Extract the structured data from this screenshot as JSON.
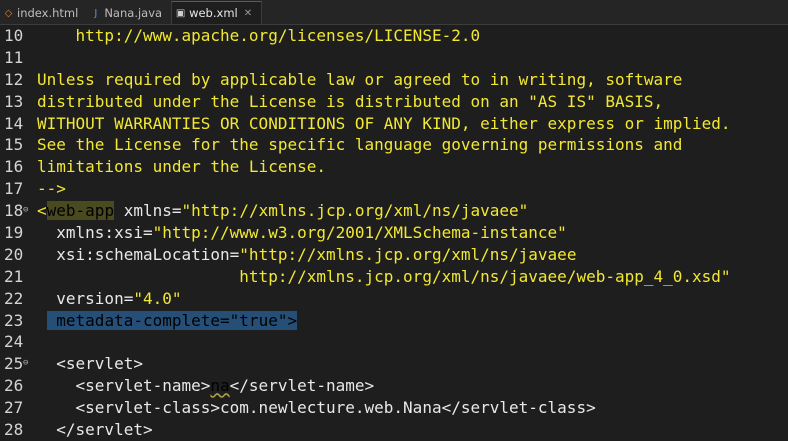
{
  "tabs": [
    {
      "label": "index.html",
      "icon": "html-file-icon",
      "active": false
    },
    {
      "label": "Nana.java",
      "icon": "java-file-icon",
      "active": false
    },
    {
      "label": "web.xml",
      "icon": "xml-file-icon",
      "active": true,
      "close": "✕"
    }
  ],
  "lines": [
    {
      "n": "10",
      "t": [
        [
          "cm",
          "    http://www.apache.org/licenses/LICENSE-2.0"
        ]
      ]
    },
    {
      "n": "11",
      "t": []
    },
    {
      "n": "12",
      "t": [
        [
          "cm",
          "Unless required by applicable law or agreed to in writing, software"
        ]
      ]
    },
    {
      "n": "13",
      "t": [
        [
          "cm",
          "distributed under the License is distributed on an \"AS IS\" BASIS,"
        ]
      ]
    },
    {
      "n": "14",
      "t": [
        [
          "cm",
          "WITHOUT WARRANTIES OR CONDITIONS OF ANY KIND, either express or implied."
        ]
      ]
    },
    {
      "n": "15",
      "t": [
        [
          "cm",
          "See the License for the specific language governing permissions and"
        ]
      ]
    },
    {
      "n": "16",
      "t": [
        [
          "cm",
          "limitations under the License."
        ]
      ]
    },
    {
      "n": "17",
      "t": [
        [
          "cm",
          "-->"
        ]
      ]
    },
    {
      "n": "18",
      "fold": "⊖",
      "t": [
        [
          "br",
          "<"
        ],
        [
          "tagname-hl",
          "web-app"
        ],
        [
          "attr",
          " xmlns="
        ],
        [
          "val",
          "\"http://xmlns.jcp.org/xml/ns/javaee\""
        ]
      ]
    },
    {
      "n": "19",
      "t": [
        [
          "attr",
          "  xmlns:xsi="
        ],
        [
          "val",
          "\"http://www.w3.org/2001/XMLSchema-instance\""
        ]
      ]
    },
    {
      "n": "20",
      "t": [
        [
          "attr",
          "  xsi:schemaLocation="
        ],
        [
          "val",
          "\"http://xmlns.jcp.org/xml/ns/javaee"
        ]
      ]
    },
    {
      "n": "21",
      "t": [
        [
          "val",
          "                     http://xmlns.jcp.org/xml/ns/javaee/web-app_4_0.xsd\""
        ]
      ]
    },
    {
      "n": "22",
      "t": [
        [
          "attr",
          "  version="
        ],
        [
          "val",
          "\"4.0\""
        ]
      ]
    },
    {
      "n": "23",
      "t": [
        [
          "txt",
          " "
        ],
        [
          "hl-sel",
          " metadata-complete=\"true\">"
        ]
      ]
    },
    {
      "n": "24",
      "t": []
    },
    {
      "n": "25",
      "fold": "⊖",
      "t": [
        [
          "tag",
          "  <servlet>"
        ]
      ]
    },
    {
      "n": "26",
      "t": [
        [
          "tag",
          "    <servlet-name>"
        ],
        [
          "squig",
          "na"
        ],
        [
          "tag",
          "</servlet-name>"
        ]
      ]
    },
    {
      "n": "27",
      "t": [
        [
          "tag",
          "    <servlet-class>com.newlecture.web.Nana</servlet-class>"
        ]
      ]
    },
    {
      "n": "28",
      "t": [
        [
          "tag",
          "  </servlet>"
        ]
      ]
    }
  ]
}
